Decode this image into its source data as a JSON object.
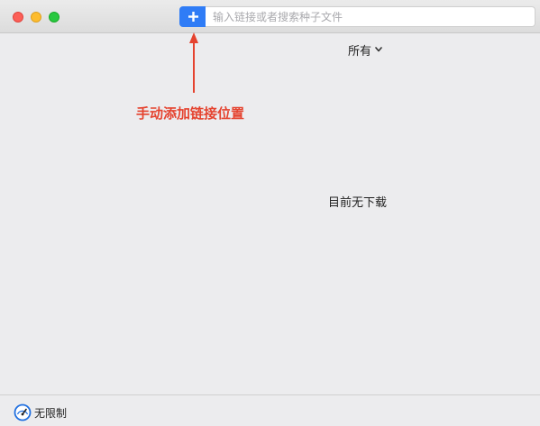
{
  "window": {
    "controls": {
      "close": "close-button",
      "minimize": "minimize-button",
      "zoom": "zoom-button"
    }
  },
  "toolbar": {
    "add_icon": "plus-icon",
    "search_placeholder": "输入链接或者搜索种子文件",
    "search_value": "",
    "accent_color": "#2f7cf6"
  },
  "filter": {
    "selected": "所有",
    "icon": "chevron-down-icon"
  },
  "annotation": {
    "text": "手动添加链接位置",
    "color": "#e5432f"
  },
  "main": {
    "empty_text": "目前无下载"
  },
  "footer": {
    "speed_icon": "speedometer-icon",
    "speed_label": "无限制"
  }
}
